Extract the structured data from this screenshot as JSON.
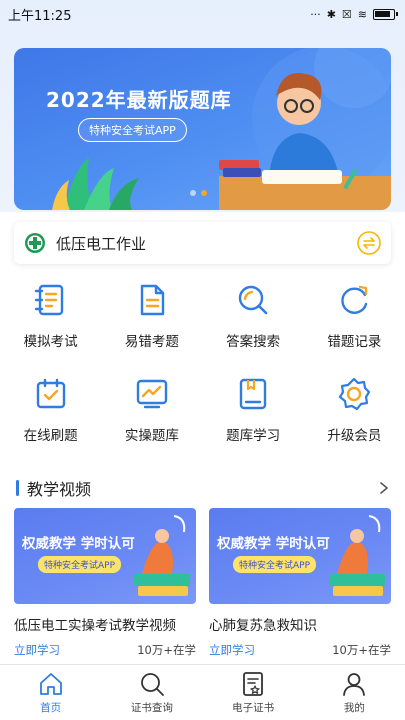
{
  "status_bar": {
    "time": "上午11:25"
  },
  "banner": {
    "title": "2022年最新版题库",
    "subtitle": "特种安全考试APP"
  },
  "category": {
    "label": "低压电工作业"
  },
  "features": [
    {
      "label": "模拟考试",
      "icon": "exam-doc-icon"
    },
    {
      "label": "易错考题",
      "icon": "error-doc-icon"
    },
    {
      "label": "答案搜索",
      "icon": "search-answer-icon"
    },
    {
      "label": "错题记录",
      "icon": "record-refresh-icon"
    },
    {
      "label": "在线刷题",
      "icon": "calendar-check-icon"
    },
    {
      "label": "实操题库",
      "icon": "chart-board-icon"
    },
    {
      "label": "题库学习",
      "icon": "book-study-icon"
    },
    {
      "label": "升级会员",
      "icon": "gear-member-icon"
    }
  ],
  "videos_section": {
    "title": "教学视频"
  },
  "videos": [
    {
      "thumb_title": "权威教学 学时认可",
      "thumb_pill": "特种安全考试APP",
      "title": "低压电工实操考试教学视频",
      "cta": "立即学习",
      "count": "10万+在学"
    },
    {
      "thumb_title": "权威教学 学时认可",
      "thumb_pill": "特种安全考试APP",
      "title": "心肺复苏急救知识",
      "cta": "立即学习",
      "count": "10万+在学"
    }
  ],
  "tabbar": [
    {
      "label": "首页",
      "icon": "home-icon",
      "active": true
    },
    {
      "label": "证书查询",
      "icon": "search-icon",
      "active": false
    },
    {
      "label": "电子证书",
      "icon": "certificate-icon",
      "active": false
    },
    {
      "label": "我的",
      "icon": "user-icon",
      "active": false
    }
  ],
  "colors": {
    "accent": "#2f7de1",
    "banner": "#4f8ff2",
    "swap": "#f5b700"
  }
}
